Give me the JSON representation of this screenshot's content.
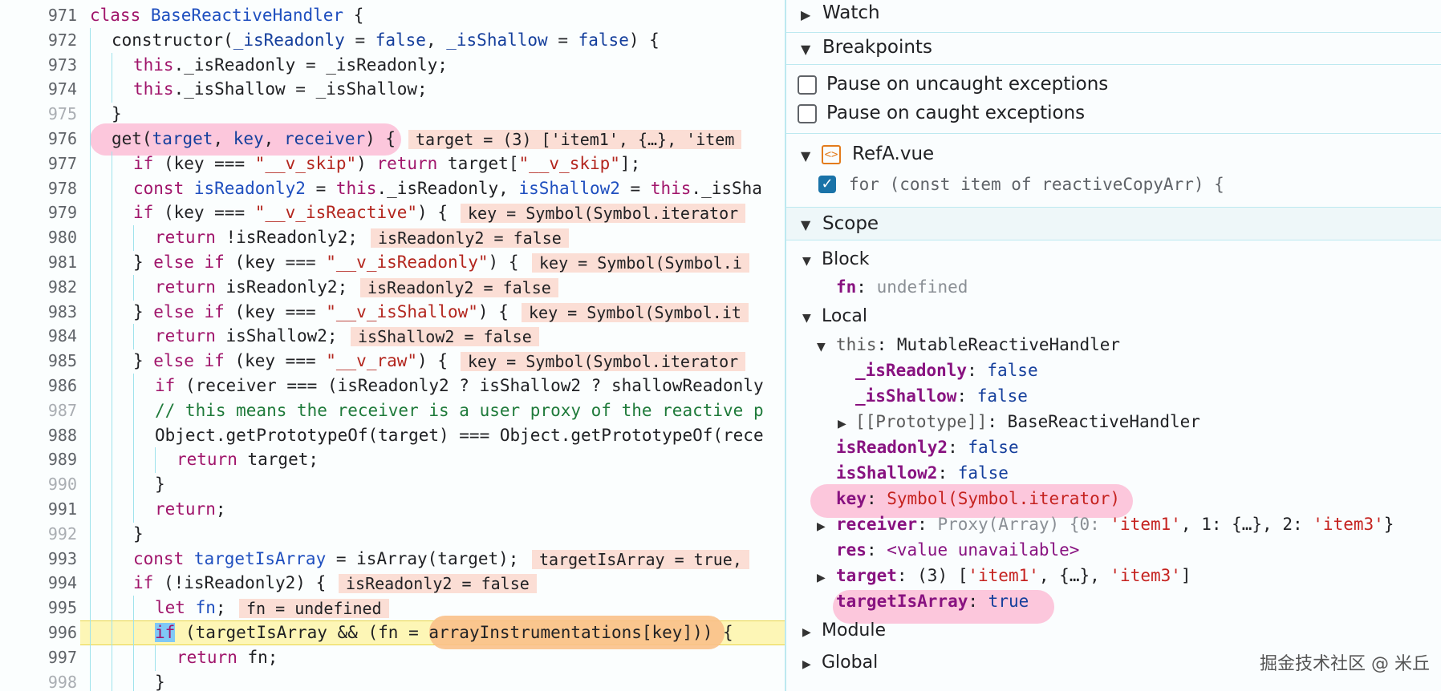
{
  "code_lines": [
    {
      "num": "971",
      "indent": 0,
      "dim": false,
      "html_tokens": [
        [
          "kw",
          "class "
        ],
        [
          "cls",
          "BaseReactiveHandler"
        ],
        [
          "",
          " {"
        ]
      ],
      "inline": ""
    },
    {
      "num": "972",
      "indent": 1,
      "dim": false,
      "html_tokens": [
        [
          "",
          "constructor("
        ],
        [
          "par",
          "_isReadonly"
        ],
        [
          "",
          " = "
        ],
        [
          "fal",
          "false"
        ],
        [
          "",
          ", "
        ],
        [
          "par",
          "_isShallow"
        ],
        [
          "",
          " = "
        ],
        [
          "fal",
          "false"
        ],
        [
          "",
          ") {"
        ]
      ],
      "inline": ""
    },
    {
      "num": "973",
      "indent": 2,
      "dim": false,
      "html_tokens": [
        [
          "kw",
          "this"
        ],
        [
          "",
          "._isReadonly = _isReadonly;"
        ]
      ],
      "inline": ""
    },
    {
      "num": "974",
      "indent": 2,
      "dim": false,
      "html_tokens": [
        [
          "kw",
          "this"
        ],
        [
          "",
          "._isShallow = _isShallow;"
        ]
      ],
      "inline": ""
    },
    {
      "num": "975",
      "indent": 1,
      "dim": true,
      "html_tokens": [
        [
          "",
          "}"
        ]
      ],
      "inline": ""
    },
    {
      "num": "976",
      "indent": 1,
      "dim": false,
      "html_tokens": [
        [
          "",
          "get("
        ],
        [
          "par",
          "target"
        ],
        [
          "",
          ", "
        ],
        [
          "par",
          "key"
        ],
        [
          "",
          ", "
        ],
        [
          "par",
          "receiver"
        ],
        [
          "",
          ") {"
        ]
      ],
      "inline": "target = (3) ['item1', {…}, 'item"
    },
    {
      "num": "977",
      "indent": 2,
      "dim": false,
      "html_tokens": [
        [
          "kw",
          "if"
        ],
        [
          "",
          " (key === "
        ],
        [
          "str",
          "\"__v_skip\""
        ],
        [
          "",
          ") "
        ],
        [
          "kw",
          "return"
        ],
        [
          "",
          " target["
        ],
        [
          "str",
          "\"__v_skip\""
        ],
        [
          "",
          "];"
        ]
      ],
      "inline": ""
    },
    {
      "num": "978",
      "indent": 2,
      "dim": false,
      "html_tokens": [
        [
          "kw",
          "const "
        ],
        [
          "cls",
          "isReadonly2"
        ],
        [
          "",
          " = "
        ],
        [
          "kw",
          "this"
        ],
        [
          "",
          "._isReadonly, "
        ],
        [
          "cls",
          "isShallow2"
        ],
        [
          "",
          " = "
        ],
        [
          "kw",
          "this"
        ],
        [
          "",
          "._isSha"
        ]
      ],
      "inline": ""
    },
    {
      "num": "979",
      "indent": 2,
      "dim": false,
      "html_tokens": [
        [
          "kw",
          "if"
        ],
        [
          "",
          " (key === "
        ],
        [
          "str",
          "\"__v_isReactive\""
        ],
        [
          "",
          ") {"
        ]
      ],
      "inline": "key = Symbol(Symbol.iterator"
    },
    {
      "num": "980",
      "indent": 3,
      "dim": false,
      "html_tokens": [
        [
          "kw",
          "return"
        ],
        [
          "",
          " !isReadonly2;"
        ]
      ],
      "inline": "isReadonly2 = false"
    },
    {
      "num": "981",
      "indent": 2,
      "dim": false,
      "html_tokens": [
        [
          "",
          "} "
        ],
        [
          "kw",
          "else if"
        ],
        [
          "",
          " (key === "
        ],
        [
          "str",
          "\"__v_isReadonly\""
        ],
        [
          "",
          ") {"
        ]
      ],
      "inline": "key = Symbol(Symbol.i"
    },
    {
      "num": "982",
      "indent": 3,
      "dim": false,
      "html_tokens": [
        [
          "kw",
          "return"
        ],
        [
          "",
          " isReadonly2;"
        ]
      ],
      "inline": "isReadonly2 = false"
    },
    {
      "num": "983",
      "indent": 2,
      "dim": false,
      "html_tokens": [
        [
          "",
          "} "
        ],
        [
          "kw",
          "else if"
        ],
        [
          "",
          " (key === "
        ],
        [
          "str",
          "\"__v_isShallow\""
        ],
        [
          "",
          ") {"
        ]
      ],
      "inline": "key = Symbol(Symbol.it"
    },
    {
      "num": "984",
      "indent": 3,
      "dim": false,
      "html_tokens": [
        [
          "kw",
          "return"
        ],
        [
          "",
          " isShallow2;"
        ]
      ],
      "inline": "isShallow2 = false"
    },
    {
      "num": "985",
      "indent": 2,
      "dim": false,
      "html_tokens": [
        [
          "",
          "} "
        ],
        [
          "kw",
          "else if"
        ],
        [
          "",
          " (key === "
        ],
        [
          "str",
          "\"__v_raw\""
        ],
        [
          "",
          ") {"
        ]
      ],
      "inline": "key = Symbol(Symbol.iterator"
    },
    {
      "num": "986",
      "indent": 3,
      "dim": false,
      "html_tokens": [
        [
          "kw",
          "if"
        ],
        [
          "",
          " (receiver === (isReadonly2 ? isShallow2 ? shallowReadonly"
        ]
      ],
      "inline": ""
    },
    {
      "num": "987",
      "indent": 3,
      "dim": true,
      "html_tokens": [
        [
          "com",
          "// this means the receiver is a user proxy of the reactive p"
        ]
      ],
      "inline": ""
    },
    {
      "num": "988",
      "indent": 3,
      "dim": false,
      "html_tokens": [
        [
          "",
          "Object.getPrototypeOf(target) === Object.getPrototypeOf(rece"
        ]
      ],
      "inline": ""
    },
    {
      "num": "989",
      "indent": 4,
      "dim": false,
      "html_tokens": [
        [
          "kw",
          "return"
        ],
        [
          "",
          " target;"
        ]
      ],
      "inline": ""
    },
    {
      "num": "990",
      "indent": 3,
      "dim": true,
      "html_tokens": [
        [
          "",
          "}"
        ]
      ],
      "inline": ""
    },
    {
      "num": "991",
      "indent": 3,
      "dim": false,
      "html_tokens": [
        [
          "kw",
          "return"
        ],
        [
          "",
          ";"
        ]
      ],
      "inline": ""
    },
    {
      "num": "992",
      "indent": 2,
      "dim": true,
      "html_tokens": [
        [
          "",
          "}"
        ]
      ],
      "inline": ""
    },
    {
      "num": "993",
      "indent": 2,
      "dim": false,
      "html_tokens": [
        [
          "kw",
          "const "
        ],
        [
          "cls",
          "targetIsArray"
        ],
        [
          "",
          " = isArray(target);"
        ]
      ],
      "inline": "targetIsArray = true,"
    },
    {
      "num": "994",
      "indent": 2,
      "dim": false,
      "html_tokens": [
        [
          "kw",
          "if"
        ],
        [
          "",
          " (!isReadonly2) {"
        ]
      ],
      "inline": "isReadonly2 = false"
    },
    {
      "num": "995",
      "indent": 3,
      "dim": false,
      "html_tokens": [
        [
          "kw",
          "let "
        ],
        [
          "cls",
          "fn"
        ],
        [
          "",
          ";"
        ]
      ],
      "inline": "fn = undefined"
    },
    {
      "num": "996",
      "indent": 3,
      "dim": false,
      "html_tokens": [
        [
          "sel kw",
          "if"
        ],
        [
          "",
          " (targetIsArray && (fn = arrayInstrumentations[key])) {"
        ]
      ],
      "inline": ""
    },
    {
      "num": "997",
      "indent": 4,
      "dim": false,
      "html_tokens": [
        [
          "kw",
          "return"
        ],
        [
          "",
          " fn;"
        ]
      ],
      "inline": ""
    },
    {
      "num": "998",
      "indent": 3,
      "dim": true,
      "html_tokens": [
        [
          "",
          "}"
        ]
      ],
      "inline": ""
    }
  ],
  "panel": {
    "watch_label": "Watch",
    "breakpoints_label": "Breakpoints",
    "pause_uncaught": "Pause on uncaught exceptions",
    "pause_caught": "Pause on caught exceptions",
    "file_name": "RefA.vue",
    "bp_code": "for (const item of reactiveCopyArr) {",
    "scope_label": "Scope",
    "block_label": "Block",
    "local_label": "Local",
    "module_label": "Module",
    "global_label": "Global",
    "watermark": "掘金技术社区 @ 米丘"
  },
  "scope": {
    "block_fn_name": "fn",
    "block_fn_val": "undefined",
    "this_name": "this",
    "this_val": "MutableReactiveHandler",
    "isReadonly_name": "_isReadonly",
    "isReadonly_val": "false",
    "isShallow_name": "_isShallow",
    "isShallow_val": "false",
    "proto_name": "[[Prototype]]",
    "proto_val": "BaseReactiveHandler",
    "isReadonly2_name": "isReadonly2",
    "isReadonly2_val": "false",
    "isShallow2_name": "isShallow2",
    "isShallow2_val": "false",
    "key_name": "key",
    "key_val": "Symbol(Symbol.iterator)",
    "receiver_name": "receiver",
    "receiver_val_a": "Proxy(Array) {0: ",
    "receiver_val_b": "'item1'",
    "receiver_val_c": ", 1: {…}, 2: ",
    "receiver_val_d": "'item3'",
    "receiver_val_e": "}",
    "res_name": "res",
    "res_val": "<value unavailable>",
    "target_name": "target",
    "target_val_a": "(3) [",
    "target_val_b": "'item1'",
    "target_val_c": ", {…}, ",
    "target_val_d": "'item3'",
    "target_val_e": "]",
    "targetIsArray_name": "targetIsArray",
    "targetIsArray_val": "true"
  },
  "colors": {
    "pink_highlight": "#fcc7dc",
    "orange_highlight": "#f9c18a",
    "exec_line": "#fdf6b6",
    "inline_value_bg": "#fbded5"
  }
}
